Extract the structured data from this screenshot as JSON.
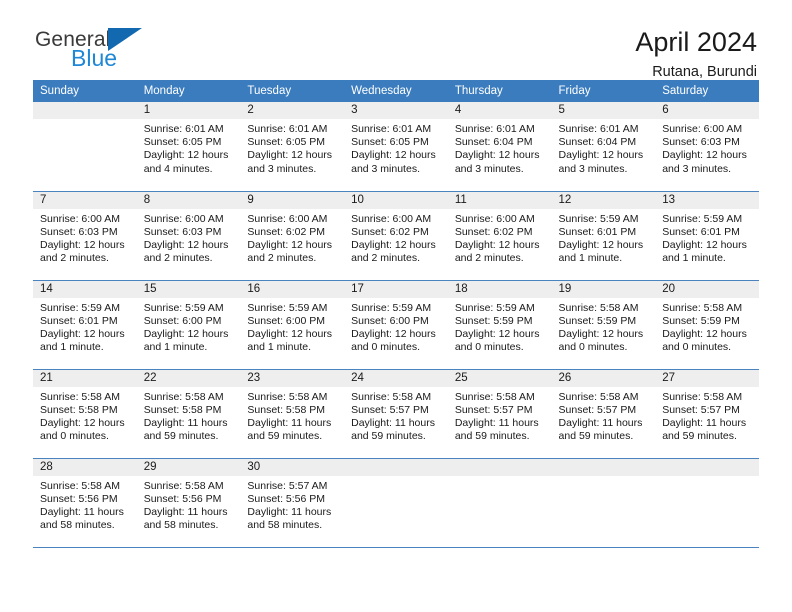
{
  "brand": {
    "line1": "General",
    "line2": "Blue",
    "triangle_icon": "brand-triangle-icon",
    "triangle_color": "#1269b0",
    "line2_color": "#1e87d6"
  },
  "header": {
    "title": "April 2024",
    "subtitle": "Rutana, Burundi"
  },
  "theme": {
    "header_row_bg": "#3a7cbe",
    "daynum_bg": "#eeeeee",
    "row_border": "#4a84c0"
  },
  "weekday_headers": [
    "Sunday",
    "Monday",
    "Tuesday",
    "Wednesday",
    "Thursday",
    "Friday",
    "Saturday"
  ],
  "labels": {
    "sunrise_prefix": "Sunrise:",
    "sunset_prefix": "Sunset:",
    "daylight_prefix": "Daylight:"
  },
  "weeks": [
    [
      {
        "empty": true
      },
      {
        "day": "1",
        "sunrise": "Sunrise: 6:01 AM",
        "sunset": "Sunset: 6:05 PM",
        "daylight1": "Daylight: 12 hours",
        "daylight2": "and 4 minutes."
      },
      {
        "day": "2",
        "sunrise": "Sunrise: 6:01 AM",
        "sunset": "Sunset: 6:05 PM",
        "daylight1": "Daylight: 12 hours",
        "daylight2": "and 3 minutes."
      },
      {
        "day": "3",
        "sunrise": "Sunrise: 6:01 AM",
        "sunset": "Sunset: 6:05 PM",
        "daylight1": "Daylight: 12 hours",
        "daylight2": "and 3 minutes."
      },
      {
        "day": "4",
        "sunrise": "Sunrise: 6:01 AM",
        "sunset": "Sunset: 6:04 PM",
        "daylight1": "Daylight: 12 hours",
        "daylight2": "and 3 minutes."
      },
      {
        "day": "5",
        "sunrise": "Sunrise: 6:01 AM",
        "sunset": "Sunset: 6:04 PM",
        "daylight1": "Daylight: 12 hours",
        "daylight2": "and 3 minutes."
      },
      {
        "day": "6",
        "sunrise": "Sunrise: 6:00 AM",
        "sunset": "Sunset: 6:03 PM",
        "daylight1": "Daylight: 12 hours",
        "daylight2": "and 3 minutes."
      }
    ],
    [
      {
        "day": "7",
        "sunrise": "Sunrise: 6:00 AM",
        "sunset": "Sunset: 6:03 PM",
        "daylight1": "Daylight: 12 hours",
        "daylight2": "and 2 minutes."
      },
      {
        "day": "8",
        "sunrise": "Sunrise: 6:00 AM",
        "sunset": "Sunset: 6:03 PM",
        "daylight1": "Daylight: 12 hours",
        "daylight2": "and 2 minutes."
      },
      {
        "day": "9",
        "sunrise": "Sunrise: 6:00 AM",
        "sunset": "Sunset: 6:02 PM",
        "daylight1": "Daylight: 12 hours",
        "daylight2": "and 2 minutes."
      },
      {
        "day": "10",
        "sunrise": "Sunrise: 6:00 AM",
        "sunset": "Sunset: 6:02 PM",
        "daylight1": "Daylight: 12 hours",
        "daylight2": "and 2 minutes."
      },
      {
        "day": "11",
        "sunrise": "Sunrise: 6:00 AM",
        "sunset": "Sunset: 6:02 PM",
        "daylight1": "Daylight: 12 hours",
        "daylight2": "and 2 minutes."
      },
      {
        "day": "12",
        "sunrise": "Sunrise: 5:59 AM",
        "sunset": "Sunset: 6:01 PM",
        "daylight1": "Daylight: 12 hours",
        "daylight2": "and 1 minute."
      },
      {
        "day": "13",
        "sunrise": "Sunrise: 5:59 AM",
        "sunset": "Sunset: 6:01 PM",
        "daylight1": "Daylight: 12 hours",
        "daylight2": "and 1 minute."
      }
    ],
    [
      {
        "day": "14",
        "sunrise": "Sunrise: 5:59 AM",
        "sunset": "Sunset: 6:01 PM",
        "daylight1": "Daylight: 12 hours",
        "daylight2": "and 1 minute."
      },
      {
        "day": "15",
        "sunrise": "Sunrise: 5:59 AM",
        "sunset": "Sunset: 6:00 PM",
        "daylight1": "Daylight: 12 hours",
        "daylight2": "and 1 minute."
      },
      {
        "day": "16",
        "sunrise": "Sunrise: 5:59 AM",
        "sunset": "Sunset: 6:00 PM",
        "daylight1": "Daylight: 12 hours",
        "daylight2": "and 1 minute."
      },
      {
        "day": "17",
        "sunrise": "Sunrise: 5:59 AM",
        "sunset": "Sunset: 6:00 PM",
        "daylight1": "Daylight: 12 hours",
        "daylight2": "and 0 minutes."
      },
      {
        "day": "18",
        "sunrise": "Sunrise: 5:59 AM",
        "sunset": "Sunset: 5:59 PM",
        "daylight1": "Daylight: 12 hours",
        "daylight2": "and 0 minutes."
      },
      {
        "day": "19",
        "sunrise": "Sunrise: 5:58 AM",
        "sunset": "Sunset: 5:59 PM",
        "daylight1": "Daylight: 12 hours",
        "daylight2": "and 0 minutes."
      },
      {
        "day": "20",
        "sunrise": "Sunrise: 5:58 AM",
        "sunset": "Sunset: 5:59 PM",
        "daylight1": "Daylight: 12 hours",
        "daylight2": "and 0 minutes."
      }
    ],
    [
      {
        "day": "21",
        "sunrise": "Sunrise: 5:58 AM",
        "sunset": "Sunset: 5:58 PM",
        "daylight1": "Daylight: 12 hours",
        "daylight2": "and 0 minutes."
      },
      {
        "day": "22",
        "sunrise": "Sunrise: 5:58 AM",
        "sunset": "Sunset: 5:58 PM",
        "daylight1": "Daylight: 11 hours",
        "daylight2": "and 59 minutes."
      },
      {
        "day": "23",
        "sunrise": "Sunrise: 5:58 AM",
        "sunset": "Sunset: 5:58 PM",
        "daylight1": "Daylight: 11 hours",
        "daylight2": "and 59 minutes."
      },
      {
        "day": "24",
        "sunrise": "Sunrise: 5:58 AM",
        "sunset": "Sunset: 5:57 PM",
        "daylight1": "Daylight: 11 hours",
        "daylight2": "and 59 minutes."
      },
      {
        "day": "25",
        "sunrise": "Sunrise: 5:58 AM",
        "sunset": "Sunset: 5:57 PM",
        "daylight1": "Daylight: 11 hours",
        "daylight2": "and 59 minutes."
      },
      {
        "day": "26",
        "sunrise": "Sunrise: 5:58 AM",
        "sunset": "Sunset: 5:57 PM",
        "daylight1": "Daylight: 11 hours",
        "daylight2": "and 59 minutes."
      },
      {
        "day": "27",
        "sunrise": "Sunrise: 5:58 AM",
        "sunset": "Sunset: 5:57 PM",
        "daylight1": "Daylight: 11 hours",
        "daylight2": "and 59 minutes."
      }
    ],
    [
      {
        "day": "28",
        "sunrise": "Sunrise: 5:58 AM",
        "sunset": "Sunset: 5:56 PM",
        "daylight1": "Daylight: 11 hours",
        "daylight2": "and 58 minutes."
      },
      {
        "day": "29",
        "sunrise": "Sunrise: 5:58 AM",
        "sunset": "Sunset: 5:56 PM",
        "daylight1": "Daylight: 11 hours",
        "daylight2": "and 58 minutes."
      },
      {
        "day": "30",
        "sunrise": "Sunrise: 5:57 AM",
        "sunset": "Sunset: 5:56 PM",
        "daylight1": "Daylight: 11 hours",
        "daylight2": "and 58 minutes."
      },
      {
        "empty": true
      },
      {
        "empty": true
      },
      {
        "empty": true
      },
      {
        "empty": true
      }
    ]
  ]
}
